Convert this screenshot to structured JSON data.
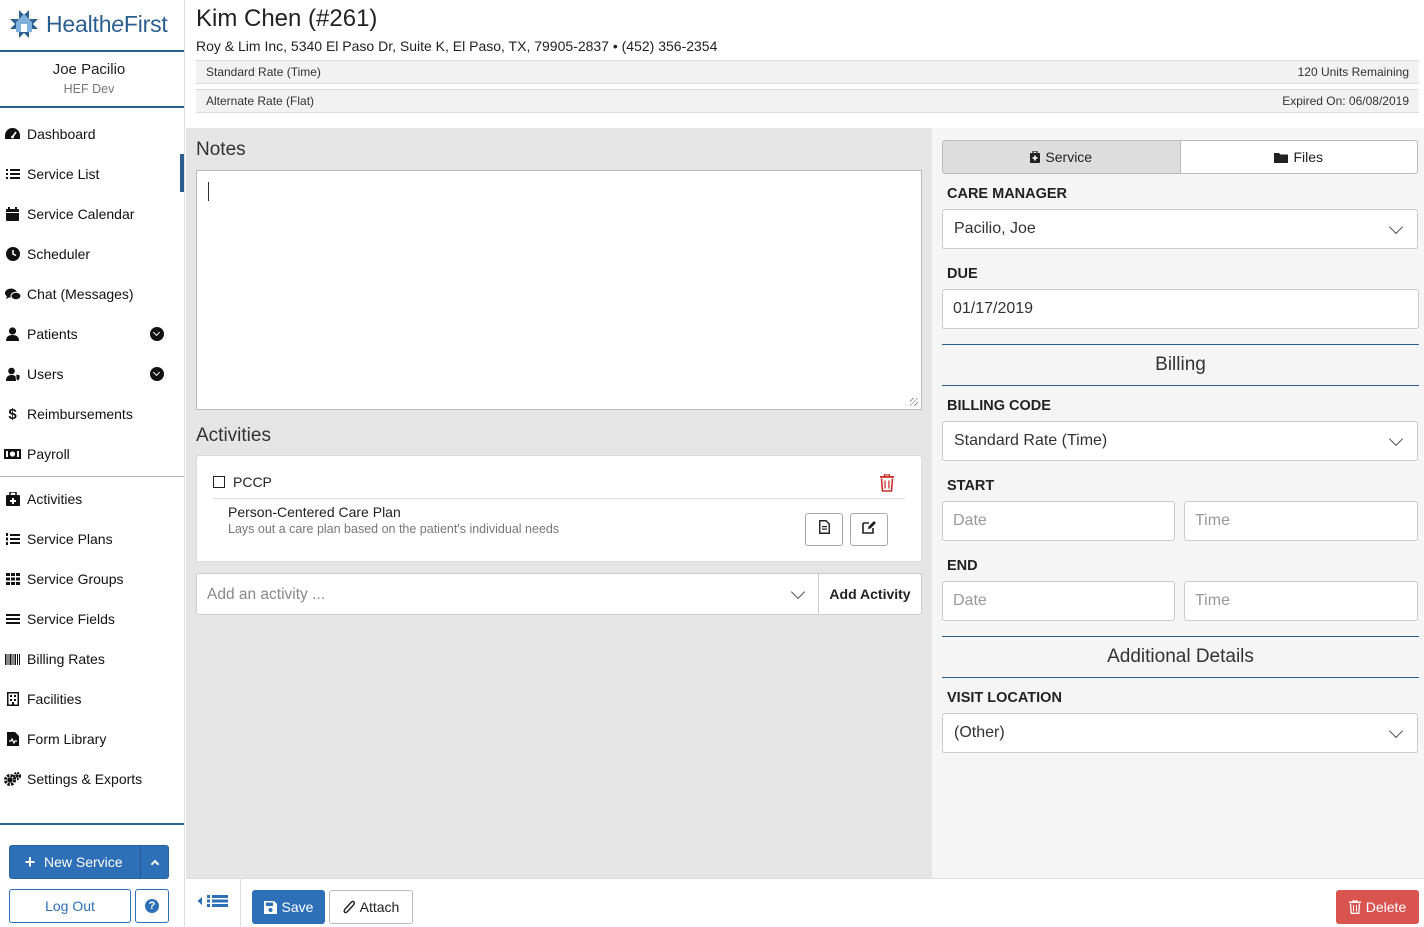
{
  "brand": {
    "name_prefix": "Health",
    "name_e": "e",
    "name_suffix": "First",
    "color": "#2b5f8f"
  },
  "user": {
    "name": "Joe Pacilio",
    "org": "HEF Dev"
  },
  "nav": {
    "primary": [
      {
        "label": "Dashboard",
        "icon": "dashboard-icon"
      },
      {
        "label": "Service List",
        "icon": "list-icon",
        "active": true
      },
      {
        "label": "Service Calendar",
        "icon": "calendar-icon"
      },
      {
        "label": "Scheduler",
        "icon": "clock-icon"
      },
      {
        "label": "Chat (Messages)",
        "icon": "chat-icon"
      },
      {
        "label": "Patients",
        "icon": "user-icon",
        "expandable": true
      },
      {
        "label": "Users",
        "icon": "user-shield-icon",
        "expandable": true
      },
      {
        "label": "Reimbursements",
        "icon": "dollar-icon"
      },
      {
        "label": "Payroll",
        "icon": "money-icon"
      }
    ],
    "secondary": [
      {
        "label": "Activities",
        "icon": "medkit-icon"
      },
      {
        "label": "Service Plans",
        "icon": "list-ol-icon"
      },
      {
        "label": "Service Groups",
        "icon": "grid-icon"
      },
      {
        "label": "Service Fields",
        "icon": "bars-icon"
      },
      {
        "label": "Billing Rates",
        "icon": "barcode-icon"
      },
      {
        "label": "Facilities",
        "icon": "building-icon"
      },
      {
        "label": "Form Library",
        "icon": "file-medical-icon"
      },
      {
        "label": "Settings & Exports",
        "icon": "cogs-icon"
      }
    ]
  },
  "sidebar_buttons": {
    "new_service": "New Service",
    "logout": "Log Out",
    "help": "?"
  },
  "patient": {
    "title": "Kim Chen (#261)",
    "address": "Roy & Lim Inc, 5340 El Paso Dr, Suite K, El Paso, TX, 79905-2837 • (452) 356-2354"
  },
  "rates": [
    {
      "name": "Standard Rate (Time)",
      "status": "120 Units Remaining"
    },
    {
      "name": "Alternate Rate (Flat)",
      "status": "Expired On: 06/08/2019"
    }
  ],
  "notes": {
    "title": "Notes",
    "value": ""
  },
  "activities": {
    "title": "Activities",
    "items": [
      {
        "code": "PCCP",
        "name": "Person-Centered Care Plan",
        "description": "Lays out a care plan based on the patient's individual needs"
      }
    ],
    "add_placeholder": "Add an activity ...",
    "add_button": "Add Activity"
  },
  "tabs": [
    {
      "label": "Service",
      "active": true
    },
    {
      "label": "Files",
      "active": false
    }
  ],
  "form": {
    "care_manager_label": "CARE MANAGER",
    "care_manager_value": "Pacilio, Joe",
    "due_label": "DUE",
    "due_value": "01/17/2019",
    "billing_section": "Billing",
    "billing_code_label": "BILLING CODE",
    "billing_code_value": "Standard Rate (Time)",
    "start_label": "START",
    "end_label": "END",
    "date_placeholder": "Date",
    "time_placeholder": "Time",
    "additional_section": "Additional Details",
    "visit_location_label": "VISIT LOCATION",
    "visit_location_value": "(Other)"
  },
  "actions": {
    "save": "Save",
    "attach": "Attach",
    "delete": "Delete"
  },
  "colors": {
    "primary": "#2e70b8",
    "danger": "#d9534f",
    "trash": "#c9302c"
  }
}
